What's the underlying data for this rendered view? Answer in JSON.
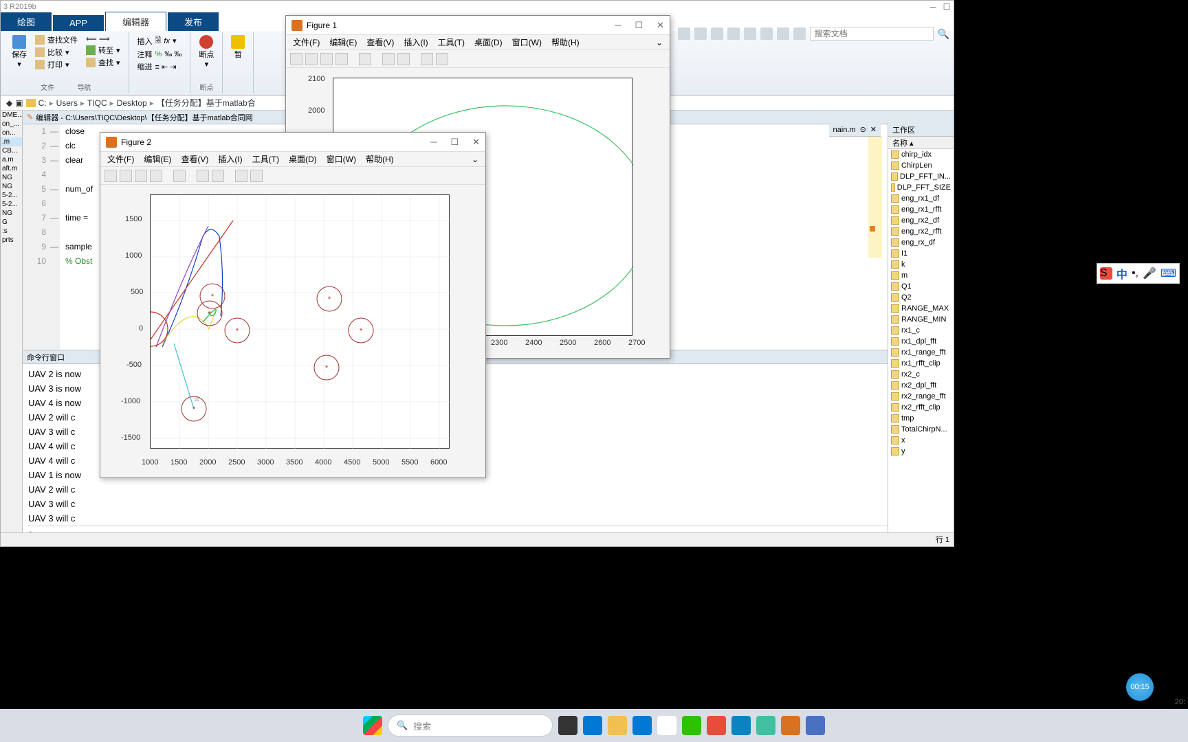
{
  "app": {
    "title": "3 R2019b"
  },
  "ribbon_tabs": {
    "plot": "绘图",
    "apps": "APP",
    "editor": "编辑器",
    "publish": "发布"
  },
  "ribbon": {
    "find_file": "查找文件",
    "compare": "比较",
    "print": "打印",
    "save": "保存",
    "nav_goto": "转至",
    "nav_find": "查找",
    "navigate": "导航",
    "file": "文件",
    "insert": "插入",
    "comment": "注释",
    "indent": "缩进",
    "fx": "fx",
    "breakpoint": "断点",
    "breakpoints": "断点",
    "pause": "暂"
  },
  "search": {
    "placeholder": "搜索文档"
  },
  "breadcrumb": [
    "C:",
    "Users",
    "TIQC",
    "Desktop",
    "【任务分配】基于matlab合"
  ],
  "editor": {
    "title": "编辑器 - C:\\Users\\TIQC\\Desktop\\【任务分配】基于matlab合同网",
    "lines": [
      {
        "n": "1",
        "c": "close"
      },
      {
        "n": "2",
        "c": "clc"
      },
      {
        "n": "3",
        "c": "clear"
      },
      {
        "n": "4",
        "c": ""
      },
      {
        "n": "5",
        "c": "num_of"
      },
      {
        "n": "6",
        "c": ""
      },
      {
        "n": "7",
        "c": "time ="
      },
      {
        "n": "8",
        "c": ""
      },
      {
        "n": "9",
        "c": "sample"
      },
      {
        "n": "10",
        "c": "% Obst"
      }
    ],
    "mainm": "nain.m"
  },
  "left_files": [
    "DME...",
    "on_...",
    "on...",
    ".m",
    "CB...",
    "a.m",
    "aft.m",
    "NG",
    "NG",
    "5-2...",
    "5-2...",
    "NG",
    "G",
    ":s",
    "prts"
  ],
  "cmd": {
    "title": "命令行窗口",
    "lines": [
      "UAV 2 is now",
      "UAV 3 is now",
      "UAV 4 is now",
      "UAV 2 will c",
      "UAV 3 will c",
      "UAV 4 will c",
      "UAV 4 will c",
      "UAV 1 is now",
      "UAV 2 will c",
      "UAV 3 will c",
      "UAV 3 will c"
    ],
    "fx": "fx"
  },
  "workspace": {
    "title": "工作区",
    "col": "名称 ▴",
    "vars": [
      "chirp_idx",
      "ChirpLen",
      "DLP_FFT_IN...",
      "DLP_FFT_SIZE",
      "eng_rx1_df",
      "eng_rx1_rfft",
      "eng_rx2_df",
      "eng_rx2_rfft",
      "eng_rx_df",
      "I1",
      "k",
      "m",
      "Q1",
      "Q2",
      "RANGE_MAX",
      "RANGE_MIN",
      "rx1_c",
      "rx1_dpl_fft",
      "rx1_range_fft",
      "rx1_rfft_clip",
      "rx2_c",
      "rx2_dpl_fft",
      "rx2_range_fft",
      "rx2_rfft_clip",
      "tmp",
      "TotalChirpN...",
      "x",
      "y"
    ]
  },
  "fig1": {
    "title": "Figure 1",
    "menus": [
      "文件(F)",
      "编辑(E)",
      "查看(V)",
      "插入(I)",
      "工具(T)",
      "桌面(D)",
      "窗口(W)",
      "帮助(H)"
    ],
    "yticks": [
      "2100",
      "2000"
    ],
    "xticks": [
      "2300",
      "2400",
      "2500",
      "2600",
      "2700"
    ]
  },
  "fig2": {
    "title": "Figure 2",
    "menus": [
      "文件(F)",
      "编辑(E)",
      "查看(V)",
      "插入(I)",
      "工具(T)",
      "桌面(D)",
      "窗口(W)",
      "帮助(H)"
    ],
    "yticks": [
      "1500",
      "1000",
      "500",
      "0",
      "-500",
      "-1000",
      "-1500"
    ],
    "xticks": [
      "1000",
      "1500",
      "2000",
      "2500",
      "3000",
      "3500",
      "4000",
      "4500",
      "5000",
      "5500",
      "6000"
    ]
  },
  "ime": {
    "label": "中"
  },
  "status": {
    "line": "行 1"
  },
  "tray": {
    "time": "00:15",
    "right": "20:"
  },
  "taskbar": {
    "search": "搜索"
  },
  "chart_data": [
    {
      "type": "line",
      "title": "Figure 1",
      "xlim": [
        2200,
        2700
      ],
      "ylim": [
        1750,
        2100
      ],
      "series": [
        {
          "name": "ellipse",
          "note": "green ellipse roughly centered ~ (2480,1950), radii ~ (230,150)"
        }
      ]
    },
    {
      "type": "scatter",
      "title": "Figure 2",
      "xlim": [
        1000,
        6000
      ],
      "ylim": [
        -1500,
        1500
      ],
      "points_red_star": [
        {
          "x": 2050,
          "y": 460
        },
        {
          "x": 2020,
          "y": 220
        },
        {
          "x": 2480,
          "y": -20
        },
        {
          "x": 4100,
          "y": 420
        },
        {
          "x": 4050,
          "y": -530
        },
        {
          "x": 4650,
          "y": -20
        },
        {
          "x": 1750,
          "y": -1090
        }
      ],
      "circles_around_points_radius": 150,
      "star_black": {
        "x": 1740,
        "y": -1000
      },
      "trajectories": [
        {
          "name": "blue",
          "approx": [
            [
              1200,
              -250
            ],
            [
              1600,
              400
            ],
            [
              1900,
              1250
            ],
            [
              2000,
              1300
            ],
            [
              2200,
              700
            ],
            [
              2200,
              180
            ]
          ]
        },
        {
          "name": "red",
          "approx": [
            [
              1000,
              -150
            ],
            [
              2400,
              1500
            ]
          ]
        },
        {
          "name": "yellow",
          "approx": [
            [
              1200,
              -200
            ],
            [
              1700,
              200
            ],
            [
              2000,
              0
            ],
            [
              2100,
              200
            ]
          ]
        },
        {
          "name": "green",
          "approx": [
            [
              1900,
              100
            ],
            [
              2200,
              350
            ],
            [
              2100,
              200
            ],
            [
              2000,
              250
            ]
          ]
        },
        {
          "name": "purple",
          "approx": [
            [
              1100,
              -250
            ],
            [
              1600,
              800
            ],
            [
              2000,
              1350
            ]
          ]
        },
        {
          "name": "cyan",
          "approx": [
            [
              1400,
              -200
            ],
            [
              1750,
              -1000
            ]
          ]
        }
      ]
    }
  ]
}
